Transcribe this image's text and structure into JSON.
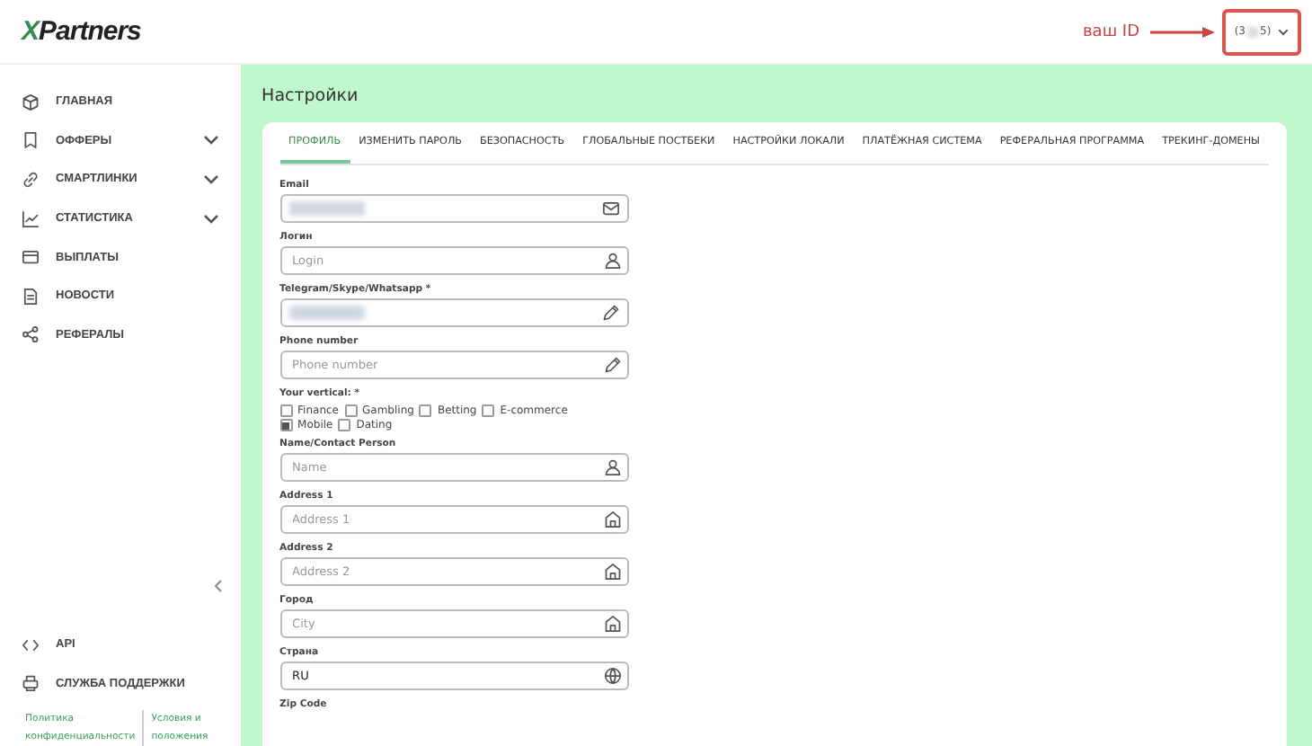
{
  "header": {
    "logo_x": "X",
    "logo_rest": "Partners",
    "annotation": "ваш ID",
    "account": {
      "id_start": "(3",
      "id_end": "5)"
    }
  },
  "sidebar": {
    "items": [
      {
        "label": "ГЛАВНАЯ",
        "kind": "home",
        "expandable": false
      },
      {
        "label": "ОФФЕРЫ",
        "kind": "bookmark",
        "expandable": true
      },
      {
        "label": "СМАРТЛИНКИ",
        "kind": "link",
        "expandable": true
      },
      {
        "label": "СТАТИСТИКА",
        "kind": "chart",
        "expandable": true
      },
      {
        "label": "ВЫПЛАТЫ",
        "kind": "card",
        "expandable": false
      },
      {
        "label": "НОВОСТИ",
        "kind": "news",
        "expandable": false
      },
      {
        "label": "РЕФЕРАЛЫ",
        "kind": "share",
        "expandable": false
      }
    ],
    "bottom_items": [
      {
        "label": "API",
        "kind": "code"
      },
      {
        "label": "СЛУЖБА ПОДДЕРЖКИ",
        "kind": "support"
      }
    ],
    "footer_links": [
      "Политика конфиденциальности",
      "Условия и положения"
    ]
  },
  "page_title": "Настройки",
  "tabs": [
    {
      "label": "ПРОФИЛЬ",
      "selected": true
    },
    {
      "label": "ИЗМЕНИТЬ ПАРОЛЬ",
      "selected": false
    },
    {
      "label": "БЕЗОПАСНОСТЬ",
      "selected": false
    },
    {
      "label": "ГЛОБАЛЬНЫЕ ПОСТБЕКИ",
      "selected": false
    },
    {
      "label": "НАСТРОЙКИ ЛОКАЛИ",
      "selected": false
    },
    {
      "label": "ПЛАТЁЖНАЯ СИСТЕМА",
      "selected": false
    },
    {
      "label": "РЕФЕРАЛЬНАЯ ПРОГРАММА",
      "selected": false
    },
    {
      "label": "ТРЕКИНГ-ДОМЕНЫ",
      "selected": false
    }
  ],
  "form": {
    "fields_top": [
      {
        "label": "Email",
        "kind": "email",
        "redacted": true
      },
      {
        "label": "Логин",
        "kind": "user",
        "placeholder": "Login"
      },
      {
        "label": "Telegram/Skype/Whatsapp *",
        "kind": "edit",
        "redacted": true
      },
      {
        "label": "Phone number",
        "kind": "edit",
        "placeholder": "Phone number"
      }
    ],
    "vertical": {
      "label": "Your vertical: *",
      "options": [
        {
          "label": "Finance",
          "checked": false
        },
        {
          "label": "Gambling",
          "checked": false
        },
        {
          "label": "Betting",
          "checked": false
        },
        {
          "label": "E-commerce",
          "checked": false
        },
        {
          "label": "Mobile",
          "checked": true
        },
        {
          "label": "Dating",
          "checked": false
        }
      ]
    },
    "fields_bottom": [
      {
        "label": "Name/Contact Person",
        "kind": "user",
        "placeholder": "Name"
      },
      {
        "label": "Address 1",
        "kind": "home",
        "placeholder": "Address 1"
      },
      {
        "label": "Address 2",
        "kind": "home",
        "placeholder": "Address 2"
      },
      {
        "label": "Город",
        "kind": "home",
        "placeholder": "City"
      },
      {
        "label": "Страна",
        "kind": "globe",
        "value": "RU"
      },
      {
        "label": "Zip Code",
        "kind": "none"
      }
    ]
  }
}
